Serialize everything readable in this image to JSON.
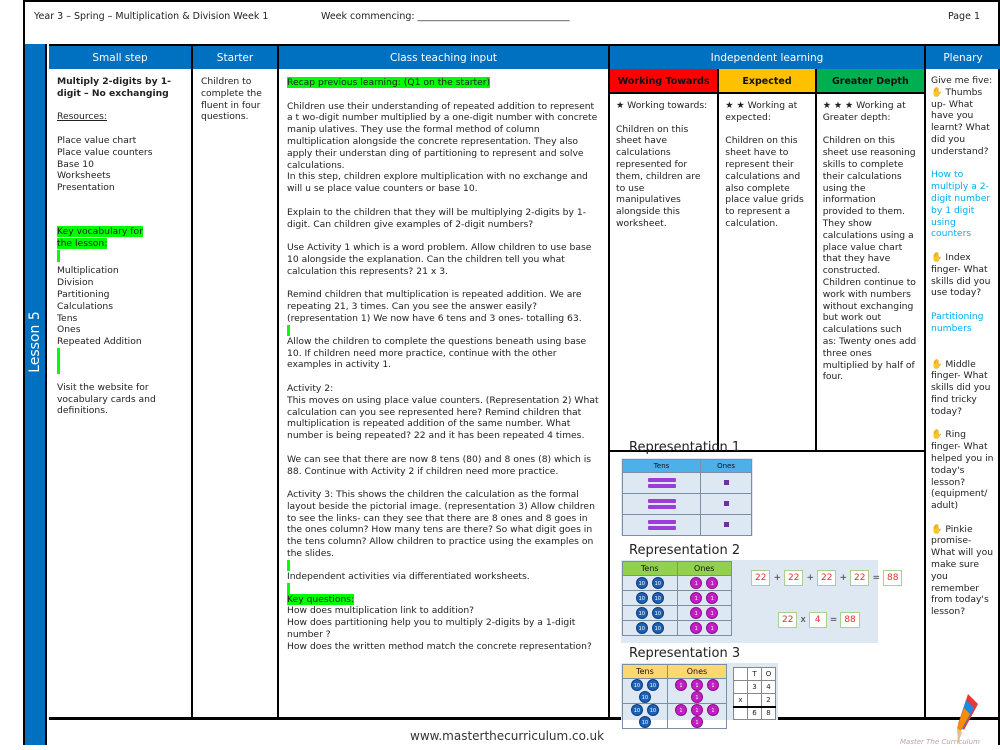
{
  "header": {
    "title": "Year 3 – Spring – Multiplication & Division Week 1",
    "week_commencing": "Week commencing: ________________________________",
    "page": "Page 1"
  },
  "lesson_label": "Lesson 5",
  "columns": {
    "small_step": "Small step",
    "starter": "Starter",
    "teaching": "Class teaching input",
    "independent": "Independent learning",
    "plenary": "Plenary"
  },
  "small_step": {
    "title": "Multiply 2-digits by 1-digit – No exchanging",
    "resources_label": "Resources:",
    "resources": [
      "Place value chart",
      "Place value counters",
      "Base 10",
      "Worksheets",
      "Presentation"
    ],
    "vocab_label": "Key vocabulary for the lesson:",
    "vocab": [
      "Multiplication",
      "Division",
      "Partitioning",
      "Calculations",
      "Tens",
      "Ones",
      "Repeated Addition"
    ],
    "website_note": "Visit the website for vocabulary cards and definitions."
  },
  "starter": {
    "text": "Children to complete the fluent in four questions."
  },
  "teaching": {
    "recap": "Recap previous learning: (Q1 on the starter)",
    "p1": "Children use their understanding of repeated addition to represent a t wo-digit number multiplied by a one-digit number with concrete manip ulatives. They use the formal method of column multiplication alongside the concrete representation. They also apply their understan ding of partitioning to represent and solve calculations.",
    "p1b": "In this step, children explore multiplication with no exchange and will u se place value counters or base 10.",
    "p2": "Explain to the children that they will be multiplying 2-digits by 1-digit. Can children give examples of 2-digit numbers?",
    "p3": "Use Activity 1 which is a word problem. Allow children to use base 10 alongside the explanation. Can the children tell you what calculation this represents? 21 x 3.",
    "p4": "Remind children that multiplication is repeated addition. We are repeating 21, 3 times. Can you see the answer easily? (representation 1) We now have 6 tens and 3 ones- totalling 63.",
    "p5": "Allow the children to complete the questions beneath using base 10. If children need more practice, continue with the other examples in activity 1.",
    "p6_title": "Activity 2:",
    "p6": "This moves on using place value counters.  (Representation 2) What calculation can you see represented here? Remind children that multiplication is repeated addition of the same number. What number is being repeated? 22 and it has been repeated 4 times.",
    "p7": "We can see that there are now 8 tens (80) and 8 ones (8) which is 88. Continue with Activity 2 if children need more practice.",
    "p8": "Activity 3: This shows the children the calculation as the formal layout beside the pictorial image. (representation 3) Allow children to see the links- can they see that there are 8 ones and 8 goes in the ones column? How many tens are there? So what digit goes in the tens column?  Allow children to practice using the examples on the slides.",
    "p9": "Independent activities via differentiated worksheets.",
    "key_questions_label": "Key questions:",
    "key_questions": [
      "How does multiplication link to addition?",
      "How does partitioning help you to multiply 2-digits by a 1-digit number ?",
      "How does the written method match the concrete representation?"
    ]
  },
  "independent": {
    "levels": [
      {
        "label": "Working Towards",
        "color": "#ff0000",
        "stars": "★ Working towards:",
        "text": "Children on this sheet have calculations represented for them, children are to use manipulatives alongside this worksheet."
      },
      {
        "label": "Expected",
        "color": "#ffc000",
        "stars": "★ ★ Working at expected:",
        "text": "Children on this sheet have to represent their calculations and also complete place value grids to represent a calculation."
      },
      {
        "label": "Greater Depth",
        "color": "#00b050",
        "stars": "★ ★ ★ Working at Greater depth:",
        "text": "Children on this sheet use reasoning skills to complete their calculations using the information provided to them. They show calculations using a place value chart that they have constructed. Children continue to work with numbers without exchanging but work out calculations such as: Twenty ones add three ones multiplied by half of four."
      }
    ],
    "representations": [
      {
        "title": "Representation 1",
        "headers": [
          "Tens",
          "Ones"
        ],
        "rows": [
          {
            "tens": 2,
            "ones": 1
          },
          {
            "tens": 2,
            "ones": 1
          },
          {
            "tens": 2,
            "ones": 1
          }
        ]
      },
      {
        "title": "Representation 2",
        "headers": [
          "Tens",
          "Ones"
        ],
        "counter_tens": "10",
        "counter_ones": "1",
        "rows": [
          {
            "tens": 2,
            "ones": 2
          },
          {
            "tens": 2,
            "ones": 2
          },
          {
            "tens": 2,
            "ones": 2
          },
          {
            "tens": 2,
            "ones": 2
          }
        ],
        "addition": [
          "22",
          "+",
          "22",
          "+",
          "22",
          "+",
          "22",
          "=",
          "88"
        ],
        "multiplication": [
          "22",
          "x",
          "4",
          "=",
          "88"
        ]
      },
      {
        "title": "Representation 3",
        "headers": [
          "Tens",
          "Ones"
        ],
        "rows": [
          {
            "tens": 3,
            "ones": 4
          },
          {
            "tens": 3,
            "ones": 4
          }
        ],
        "column_method": {
          "header": [
            "",
            "T",
            "O"
          ],
          "rows": [
            [
              "",
              "3",
              "4"
            ],
            [
              "x",
              "",
              "2"
            ],
            [
              "",
              "6",
              "8"
            ]
          ]
        }
      }
    ]
  },
  "plenary": {
    "intro": "Give me five:",
    "items": [
      {
        "icon": "✋",
        "text": "Thumbs up- What have you learnt? What did you understand?",
        "answer": "How to multiply a 2-digit number by 1 digit using counters"
      },
      {
        "icon": "✋",
        "text": "Index finger- What skills did you use today?",
        "answer": "Partitioning numbers"
      },
      {
        "icon": "✋",
        "text": "Middle finger- What skills did you find tricky today?",
        "answer": ""
      },
      {
        "icon": "✋",
        "text": "Ring finger- What helped you in today's lesson? (equipment/ adult)",
        "answer": ""
      },
      {
        "icon": "✋",
        "text": "Pinkie promise- What will you make sure you remember from today's lesson?",
        "answer": ""
      }
    ]
  },
  "footer": {
    "url": "www.masterthecurriculum.co.uk",
    "brand": "Master The Curriculum"
  }
}
